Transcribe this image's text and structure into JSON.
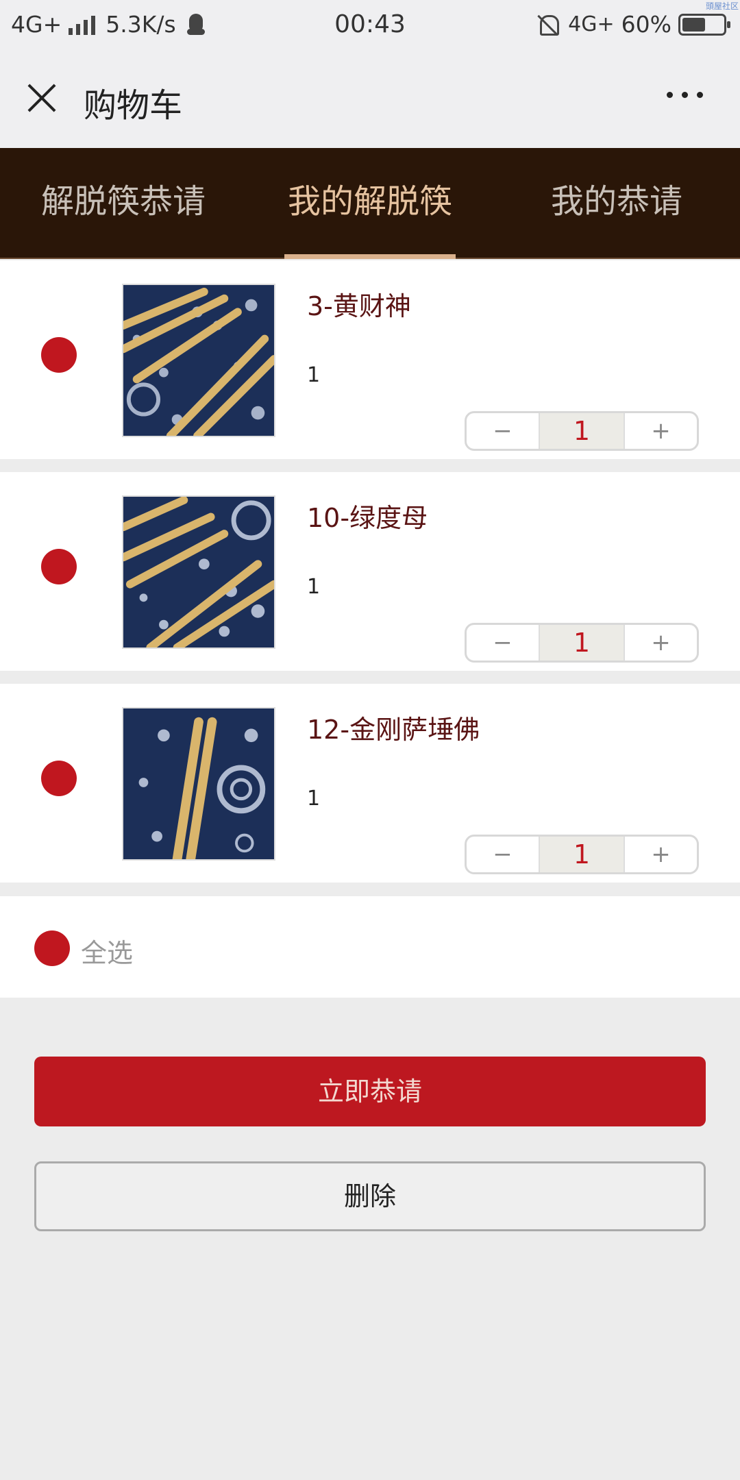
{
  "status_bar": {
    "network_left": "4G+",
    "speed": "5.3K/s",
    "time": "00:43",
    "network_right": "4G+",
    "battery": "60%",
    "watermark": "頭屋社区"
  },
  "header": {
    "title": "购物车"
  },
  "tabs": [
    {
      "label": "解脱筷恭请",
      "active": false
    },
    {
      "label": "我的解脱筷",
      "active": true
    },
    {
      "label": "我的恭请",
      "active": false
    }
  ],
  "cart_items": [
    {
      "name": "3-黄财神",
      "price": "1",
      "quantity": "1",
      "decrement": "−",
      "increment": "+"
    },
    {
      "name": "10-绿度母",
      "price": "1",
      "quantity": "1",
      "decrement": "−",
      "increment": "+"
    },
    {
      "name": "12-金刚萨埵佛",
      "price": "1",
      "quantity": "1",
      "decrement": "−",
      "increment": "+"
    }
  ],
  "select_all": {
    "label": "全选"
  },
  "actions": {
    "checkout_label": "立即恭请",
    "delete_label": "删除"
  },
  "colors": {
    "accent_red": "#c0171f",
    "tab_bar_bg": "#2a1608",
    "tab_active": "#e6c3a0"
  }
}
